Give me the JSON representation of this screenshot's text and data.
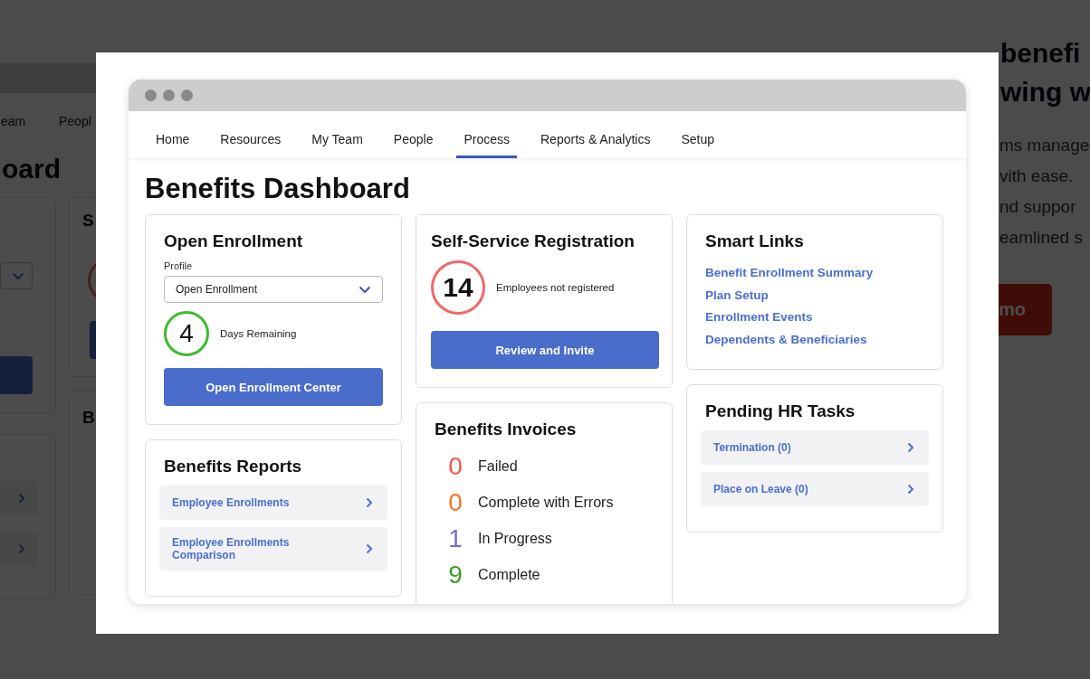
{
  "background": {
    "nav": [
      "eam",
      "Peopl"
    ],
    "heading": "oard",
    "card_letters": [
      "S",
      "B"
    ],
    "hero_title_lines": [
      "benefi",
      "wing w"
    ],
    "hero_text_lines": [
      "ms manage",
      "vith ease.",
      "nd suppor",
      "eamlined s"
    ],
    "hero_button": "mo"
  },
  "nav": [
    {
      "label": "Home",
      "selected": false
    },
    {
      "label": "Resources",
      "selected": false
    },
    {
      "label": "My Team",
      "selected": false
    },
    {
      "label": "People",
      "selected": false
    },
    {
      "label": "Process",
      "selected": true
    },
    {
      "label": "Reports & Analytics",
      "selected": false
    },
    {
      "label": "Setup",
      "selected": false
    }
  ],
  "title": "Benefits Dashboard",
  "columns": [
    [
      {
        "kind": "enrollment",
        "title": "Open Enrollment",
        "field_label": "Profile",
        "select_value": "Open Enrollment",
        "counter": {
          "value": "4",
          "label": "Days Remaining",
          "color": "#3dbb2f"
        },
        "button": "Open Enrollment Center"
      },
      {
        "kind": "list",
        "title": "Benefits Reports",
        "items": [
          "Employee Enrollments",
          "Employee Enrollments Comparison"
        ]
      }
    ],
    [
      {
        "kind": "registration",
        "title": "Self-Service Registration",
        "counter": {
          "value": "14",
          "label": "Employees not registered",
          "color": "#ee6a6a"
        },
        "button": "Review and Invite"
      },
      {
        "kind": "invoices",
        "title": "Benefits Invoices",
        "items": [
          {
            "count": "0",
            "label": "Failed",
            "color": "#ee5a4a"
          },
          {
            "count": "0",
            "label": "Complete with Errors",
            "color": "#f0792a"
          },
          {
            "count": "1",
            "label": "In Progress",
            "color": "#7a6cc4"
          },
          {
            "count": "9",
            "label": "Complete",
            "color": "#3f9a2a"
          }
        ]
      }
    ],
    [
      {
        "kind": "links",
        "title": "Smart Links",
        "links": [
          "Benefit Enrollment Summary",
          "Plan Setup",
          "Enrollment Events",
          "Dependents & Beneficiaries"
        ]
      },
      {
        "kind": "list",
        "title": "Pending HR Tasks",
        "items": [
          "Termination (0)",
          "Place on Leave (0)"
        ]
      }
    ]
  ]
}
